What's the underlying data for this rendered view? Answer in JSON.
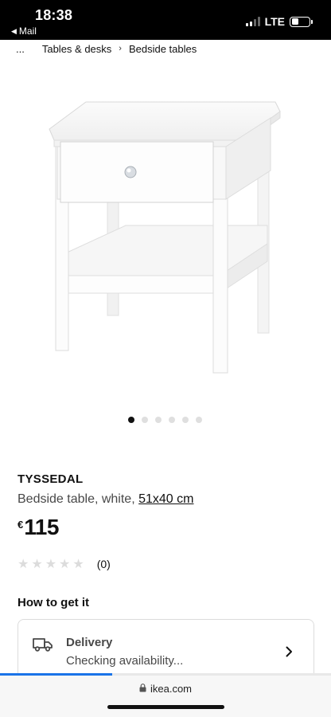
{
  "status_bar": {
    "time": "18:38",
    "back_label": "Mail",
    "network": "LTE"
  },
  "breadcrumb": {
    "ellipsis": "...",
    "items": [
      "Tables & desks",
      "Bedside tables"
    ]
  },
  "carousel": {
    "total": 6,
    "active_index": 0
  },
  "product": {
    "name": "TYSSEDAL",
    "description": "Bedside table, white,",
    "size": "51x40 cm",
    "currency": "€",
    "price": "115",
    "rating_stars": 0,
    "rating_count": "(0)"
  },
  "availability": {
    "section_title": "How to get it",
    "delivery_title": "Delivery",
    "delivery_status": "Checking availability..."
  },
  "browser": {
    "url": "ikea.com",
    "load_progress": 0.34
  },
  "icons": {
    "back": "back-arrow-icon",
    "delivery": "truck-icon",
    "chevron": "chevron-right-icon",
    "lock": "lock-icon"
  },
  "colors": {
    "progress": "#1a73e8",
    "star_empty": "#dcdcdc"
  }
}
